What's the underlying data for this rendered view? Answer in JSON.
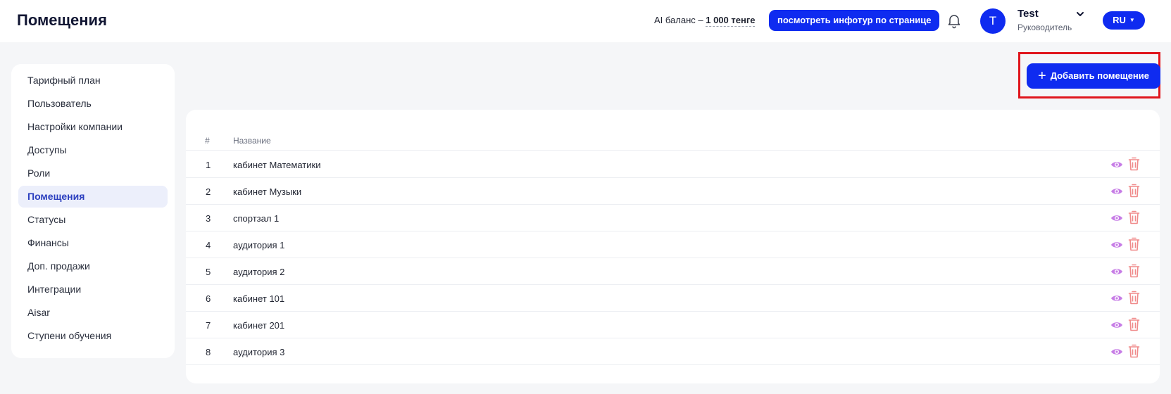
{
  "header": {
    "title": "Помещения",
    "ai_balance_label": "AI баланс –",
    "ai_balance_value": "1 000 тенге",
    "tour_button": "посмотреть инфотур по странице",
    "user": {
      "initial": "T",
      "name": "Test",
      "role": "Руководитель"
    },
    "language": "RU"
  },
  "sidebar": {
    "items": [
      {
        "label": "Тарифный план"
      },
      {
        "label": "Пользователь"
      },
      {
        "label": "Настройки компании"
      },
      {
        "label": "Доступы"
      },
      {
        "label": "Роли"
      },
      {
        "label": "Помещения",
        "active": true
      },
      {
        "label": "Статусы"
      },
      {
        "label": "Финансы"
      },
      {
        "label": "Доп. продажи"
      },
      {
        "label": "Интеграции"
      },
      {
        "label": "Aisar"
      },
      {
        "label": "Ступени обучения"
      }
    ]
  },
  "actions": {
    "add_button": "Добавить помещение"
  },
  "table": {
    "headers": {
      "num": "#",
      "name": "Название"
    },
    "rows": [
      {
        "num": "1",
        "name": "кабинет Математики"
      },
      {
        "num": "2",
        "name": "кабинет Музыки"
      },
      {
        "num": "3",
        "name": "спортзал 1"
      },
      {
        "num": "4",
        "name": "аудитория 1"
      },
      {
        "num": "5",
        "name": "аудитория 2"
      },
      {
        "num": "6",
        "name": "кабинет 101"
      },
      {
        "num": "7",
        "name": "кабинет 201"
      },
      {
        "num": "8",
        "name": "аудитория 3"
      }
    ]
  },
  "colors": {
    "primary": "#0f2bf0",
    "view_icon": "#c77de6",
    "delete_icon": "#f08a8a",
    "highlight": "#e0161d"
  }
}
